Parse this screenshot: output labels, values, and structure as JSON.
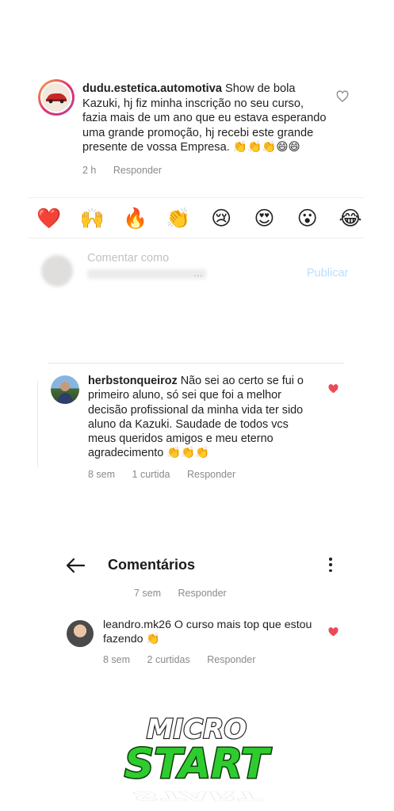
{
  "comments": [
    {
      "username": "dudu.estetica.automotiva",
      "text": "Show de bola Kazuki, hj fiz minha inscrição no seu curso, fazia mais de um ano que eu estava esperando uma grande promoção, hj recebi este grande presente de vossa Empresa. 👏👏👏😄😄",
      "time": "2 h",
      "reply": "Responder"
    },
    {
      "username": "herbstonqueiroz",
      "text": "Não sei ao certo se fui o primeiro aluno, só sei que foi a melhor decisão profissional da minha vida ter sido aluno da Kazuki.  Saudade de todos vcs meus queridos amigos e meu eterno agradecimento 👏👏👏",
      "time": "8 sem",
      "likes": "1 curtida",
      "reply": "Responder"
    },
    {
      "username": "leandro.mk26",
      "text": "O curso mais top que estou fazendo 👏",
      "time": "8 sem",
      "likes": "2 curtidas",
      "reply": "Responder"
    }
  ],
  "reactions": [
    "❤️",
    "🙌",
    "🔥",
    "👏",
    "😢",
    "😍",
    "😮",
    "😂"
  ],
  "composer": {
    "placeholder": "Comentar como",
    "blurred_suffix": "...",
    "publish": "Publicar"
  },
  "header": {
    "title": "Comentários",
    "prev_time": "7 sem",
    "prev_reply": "Responder"
  },
  "logo": {
    "line1": "MICRO",
    "line2": "START"
  },
  "colors": {
    "like_red": "#ed4956",
    "publish_blue": "#b7dffb",
    "logo_green": "#2ecc2e"
  }
}
